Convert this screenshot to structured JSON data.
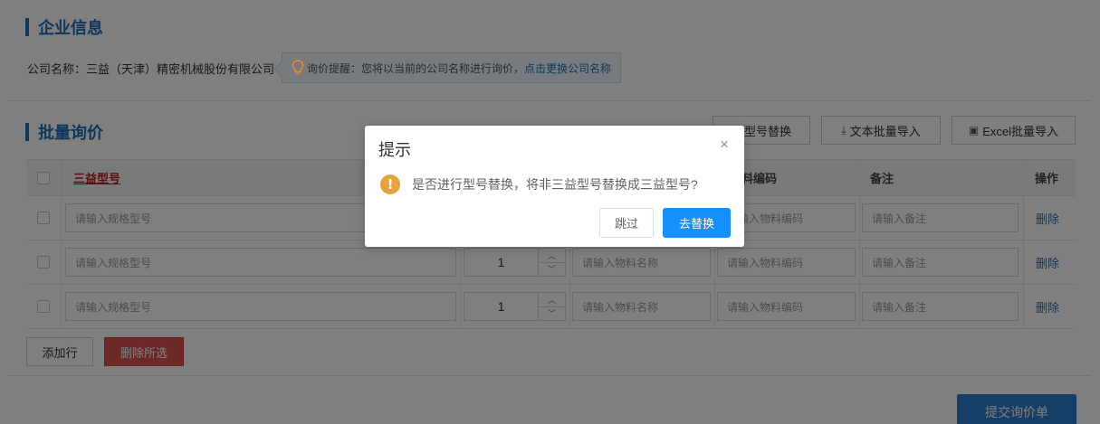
{
  "company": {
    "section_title": "企业信息",
    "name_label": "公司名称：",
    "name_value": "三益（天津）精密机械股份有限公司",
    "tip_text": "询价提醒：您将以当前的公司名称进行询价，",
    "tip_link": "点击更换公司名称"
  },
  "inquiry": {
    "section_title": "批量询价",
    "toolbar": {
      "replace_label": "型号替换",
      "text_import_label": "文本批量导入",
      "excel_import_label": "Excel批量导入",
      "text_import_icon": "download-icon",
      "excel_import_icon": "excel-icon"
    },
    "columns": {
      "model": "三益型号",
      "code": "料编码",
      "remark": "备注",
      "action": "操作"
    },
    "rows": [
      {
        "model_placeholder": "请输入规格型号",
        "quantity": "",
        "name_placeholder": "",
        "code_placeholder": "请输入物料编码",
        "remark_placeholder": "请输入备注",
        "delete_label": "删除"
      },
      {
        "model_placeholder": "请输入规格型号",
        "quantity": "1",
        "name_placeholder": "请输入物料名称",
        "code_placeholder": "请输入物料编码",
        "remark_placeholder": "请输入备注",
        "delete_label": "删除"
      },
      {
        "model_placeholder": "请输入规格型号",
        "quantity": "1",
        "name_placeholder": "请输入物料名称",
        "code_placeholder": "请输入物料编码",
        "remark_placeholder": "请输入备注",
        "delete_label": "删除"
      }
    ],
    "add_row_label": "添加行",
    "delete_selected_label": "删除所选",
    "submit_label": "提交询价单"
  },
  "dialog": {
    "title": "提示",
    "message": "是否进行型号替换，将非三益型号替换成三益型号?",
    "skip_label": "跳过",
    "confirm_label": "去替换",
    "icon": "warning-icon"
  },
  "colors": {
    "brand_blue": "#1f6fb6",
    "primary_button": "#1790ff",
    "danger_button": "#d9534f",
    "warning": "#e6a23c",
    "required_text": "#c0161b"
  }
}
